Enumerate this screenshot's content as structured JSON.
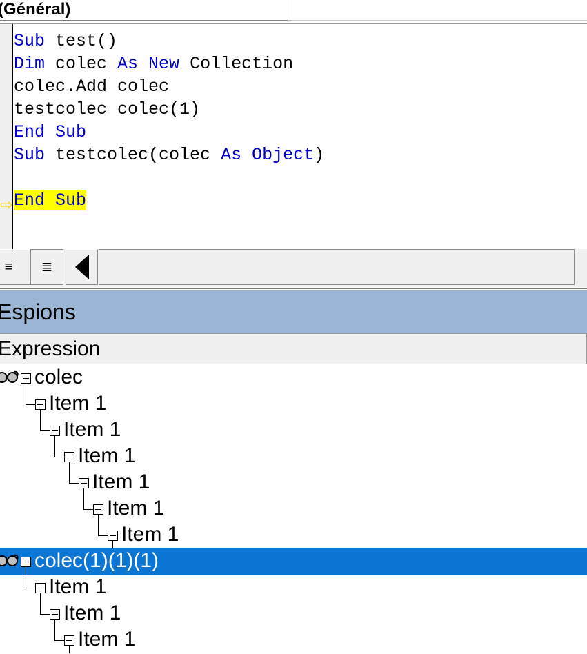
{
  "code_window": {
    "object_combo": {
      "value": "(Général)",
      "icon": "chevron-down-icon"
    },
    "execution_marker": {
      "icon": "yellow-arrow-icon",
      "glyph": "⇨"
    },
    "lines": [
      {
        "n": 1,
        "indent": 0,
        "highlight": false,
        "tokens": [
          {
            "t": "Sub ",
            "k": true
          },
          {
            "t": "test()",
            "k": false
          }
        ]
      },
      {
        "n": 2,
        "indent": 0,
        "highlight": false,
        "tokens": [
          {
            "t": "Dim ",
            "k": true
          },
          {
            "t": "colec ",
            "k": false
          },
          {
            "t": "As New ",
            "k": true
          },
          {
            "t": "Collection",
            "k": false
          }
        ]
      },
      {
        "n": 3,
        "indent": 0,
        "highlight": false,
        "tokens": [
          {
            "t": "colec.Add colec",
            "k": false
          }
        ]
      },
      {
        "n": 4,
        "indent": 0,
        "highlight": false,
        "tokens": [
          {
            "t": "testcolec colec(1)",
            "k": false
          }
        ]
      },
      {
        "n": 5,
        "indent": 0,
        "highlight": false,
        "tokens": [
          {
            "t": "End Sub",
            "k": true
          }
        ]
      },
      {
        "n": 6,
        "indent": 0,
        "highlight": false,
        "tokens": [
          {
            "t": "Sub ",
            "k": true
          },
          {
            "t": "testcolec(colec ",
            "k": false
          },
          {
            "t": "As Object",
            "k": true
          },
          {
            "t": ")",
            "k": false
          }
        ]
      },
      {
        "n": 7,
        "indent": 0,
        "highlight": false,
        "tokens": [
          {
            "t": "",
            "k": false
          }
        ]
      },
      {
        "n": 8,
        "indent": 0,
        "highlight": true,
        "tokens": [
          {
            "t": "End Sub",
            "k": true
          }
        ]
      }
    ],
    "bottom_bar": {
      "procedure_view_button": {
        "label": "≡",
        "name": "procedure-view-button"
      },
      "full_module_view_button": {
        "label": "≣",
        "name": "full-module-view-button"
      },
      "scroll_left_button": {
        "name": "hscroll-left-arrow",
        "icon": "triangle-left-icon"
      }
    }
  },
  "watch_window": {
    "title": "Espions",
    "columns": [
      "Expression"
    ],
    "rows": [
      {
        "label": "colec",
        "depth": 0,
        "has_glasses": true,
        "expanded": true,
        "selected": false
      },
      {
        "label": "Item 1",
        "depth": 1,
        "has_glasses": false,
        "expanded": true,
        "selected": false
      },
      {
        "label": "Item 1",
        "depth": 2,
        "has_glasses": false,
        "expanded": true,
        "selected": false
      },
      {
        "label": "Item 1",
        "depth": 3,
        "has_glasses": false,
        "expanded": true,
        "selected": false
      },
      {
        "label": "Item 1",
        "depth": 4,
        "has_glasses": false,
        "expanded": true,
        "selected": false
      },
      {
        "label": "Item 1",
        "depth": 5,
        "has_glasses": false,
        "expanded": true,
        "selected": false
      },
      {
        "label": "Item 1",
        "depth": 6,
        "has_glasses": false,
        "expanded": true,
        "selected": false
      },
      {
        "label": "colec(1)(1)(1)",
        "depth": 0,
        "has_glasses": true,
        "expanded": true,
        "selected": true
      },
      {
        "label": "Item 1",
        "depth": 1,
        "has_glasses": false,
        "expanded": true,
        "selected": false
      },
      {
        "label": "Item 1",
        "depth": 2,
        "has_glasses": false,
        "expanded": true,
        "selected": false
      },
      {
        "label": "Item 1",
        "depth": 3,
        "has_glasses": false,
        "expanded": true,
        "selected": false
      }
    ]
  },
  "colors": {
    "keyword": "#0000c8",
    "identifier": "#000000",
    "execution_highlight": "#ffff00",
    "selection": "#0b76d4",
    "titlebar": "#9bb5d5",
    "panel": "#f0f0f0"
  }
}
